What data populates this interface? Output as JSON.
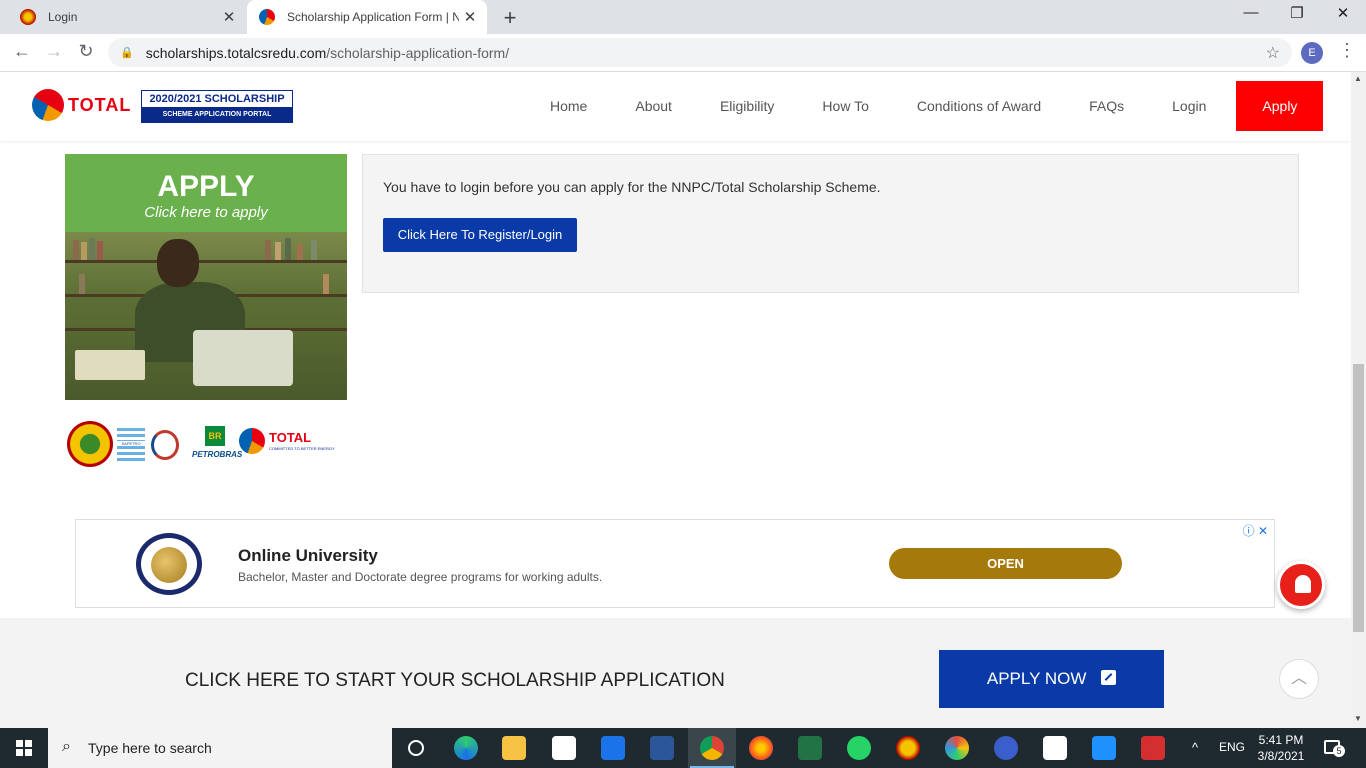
{
  "browser": {
    "tabs": [
      {
        "title": "Login",
        "active": false
      },
      {
        "title": "Scholarship Application Form | N",
        "active": true
      }
    ],
    "url_host": "scholarships.totalcsredu.com",
    "url_path": "/scholarship-application-form/",
    "profile_initial": "E"
  },
  "site": {
    "logo_text": "TOTAL",
    "badge_top": "2020/2021 SCHOLARSHIP",
    "badge_bottom": "SCHEME APPLICATION PORTAL",
    "nav": [
      "Home",
      "About",
      "Eligibility",
      "How To",
      "Conditions of Award",
      "FAQs",
      "Login",
      "Apply"
    ]
  },
  "banner": {
    "title": "APPLY",
    "subtitle": "Click here to apply"
  },
  "sponsors": {
    "sapetro": "SAPETRO",
    "petrobras": "PETROBRAS",
    "petrobras_br": "BR",
    "total_name": "TOTAL",
    "total_tagline": "COMMITTED TO BETTER ENERGY"
  },
  "notice": {
    "message": "You have to login before you can apply for the NNPC/Total Scholarship Scheme.",
    "button": "Click Here To Register/Login"
  },
  "ad": {
    "headline": "Online University",
    "description": "Bachelor, Master and Doctorate degree programs for working adults.",
    "cta": "OPEN",
    "choices_icon": "ⓘ",
    "close_icon": "✕"
  },
  "cta": {
    "text": "CLICK HERE TO START YOUR SCHOLARSHIP APPLICATION",
    "button": "APPLY NOW",
    "button_icon": "edit-icon"
  },
  "taskbar": {
    "search_placeholder": "Type here to search",
    "language": "ENG",
    "time": "5:41 PM",
    "date": "3/8/2021",
    "notification_count": "5"
  },
  "colors": {
    "brand_red": "#ff0000",
    "primary_blue": "#0a3aa8",
    "banner_green": "#6ab04c",
    "ad_button": "#a57a0b"
  }
}
